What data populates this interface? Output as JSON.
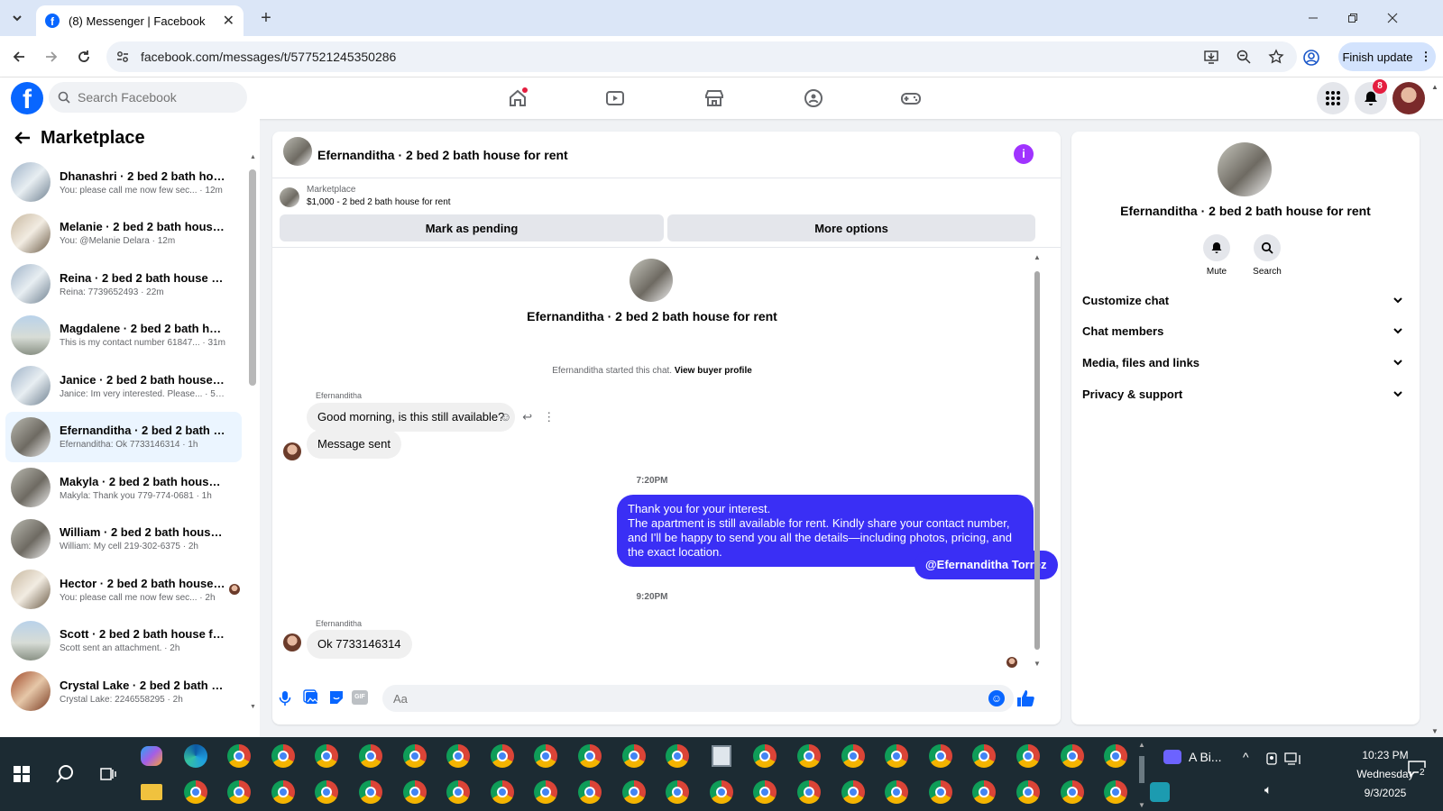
{
  "browser": {
    "tab_title": "(8) Messenger | Facebook",
    "new_tab": "+",
    "url": "facebook.com/messages/t/577521245350286",
    "finish_update": "Finish update"
  },
  "fb": {
    "search_placeholder": "Search Facebook",
    "notification_count": "8",
    "colors": {
      "brand": "#0866ff",
      "accent_purple": "#3a2ff5",
      "badge": "#e41e3f"
    }
  },
  "sidebar": {
    "title": "Marketplace",
    "conversations": [
      {
        "name": "Dhanashri · 2 bed 2 bath house ...",
        "preview": "You: please call me now few sec... · 12m",
        "active": false
      },
      {
        "name": "Melanie · 2 bed 2 bath house fo...",
        "preview": "You: @Melanie Delara · 12m",
        "active": false
      },
      {
        "name": "Reina · 2 bed 2 bath house for r...",
        "preview": "Reina: 7739652493 · 22m",
        "active": false
      },
      {
        "name": "Magdalene · 2 bed 2 bath hous...",
        "preview": "This is my contact number 61847... · 31m",
        "active": false
      },
      {
        "name": "Janice · 2 bed 2 bath house for ...",
        "preview": "Janice: Im very interested. Please... · 57m",
        "active": false
      },
      {
        "name": "Efernanditha · 2 bed 2 bath hou...",
        "preview": "Efernanditha: Ok 7733146314 · 1h",
        "active": true
      },
      {
        "name": "Makyla · 2 bed 2 bath house for...",
        "preview": "Makyla: Thank you 779-774-0681 · 1h",
        "active": false
      },
      {
        "name": "William · 2 bed 2 bath house fo...",
        "preview": "William: My cell 219-302-6375 · 2h",
        "active": false
      },
      {
        "name": "Hector · 2 bed 2 bath house f...",
        "preview": "You: please call me now few sec... · 2h",
        "active": false
      },
      {
        "name": "Scott · 2 bed 2 bath house for r...",
        "preview": "Scott sent an attachment. · 2h",
        "active": false
      },
      {
        "name": "Crystal Lake · 2 bed 2 bath hous...",
        "preview": "Crystal Lake: 2246558295 · 2h",
        "active": false
      }
    ]
  },
  "chat": {
    "title": "Efernanditha · 2 bed 2 bath house for rent",
    "marketplace_label": "Marketplace",
    "listing": "$1,000 - 2 bed 2 bath house for rent",
    "mark_pending": "Mark as pending",
    "more_options": "More options",
    "intro_name": "Efernanditha · 2 bed 2 bath house for rent",
    "started_text": "Efernanditha started this chat.",
    "view_buyer": "View buyer profile",
    "sender_name": "Efernanditha",
    "msg1": "Good morning, is this still available?",
    "msg2": "Message sent",
    "time1": "7:20PM",
    "out1_line1": "Thank you for your interest.",
    "out1_line2": "The apartment is still available for rent. Kindly share your contact number, and I'll be happy to send you all the details—including photos, pricing, and the exact location.",
    "out2": "@Efernanditha Torrez",
    "time2": "9:20PM",
    "sender_name2": "Efernanditha",
    "msg3": "Ok 7733146314",
    "composer_placeholder": "Aa"
  },
  "details": {
    "title": "Efernanditha · 2 bed 2 bath house for rent",
    "mute": "Mute",
    "search": "Search",
    "sections": [
      "Customize chat",
      "Chat members",
      "Media, files and links",
      "Privacy & support"
    ]
  },
  "taskbar": {
    "zoom_label": "A Bi...",
    "time": "10:23 PM",
    "day": "Wednesday",
    "date": "9/3/2025",
    "notif": "2"
  }
}
